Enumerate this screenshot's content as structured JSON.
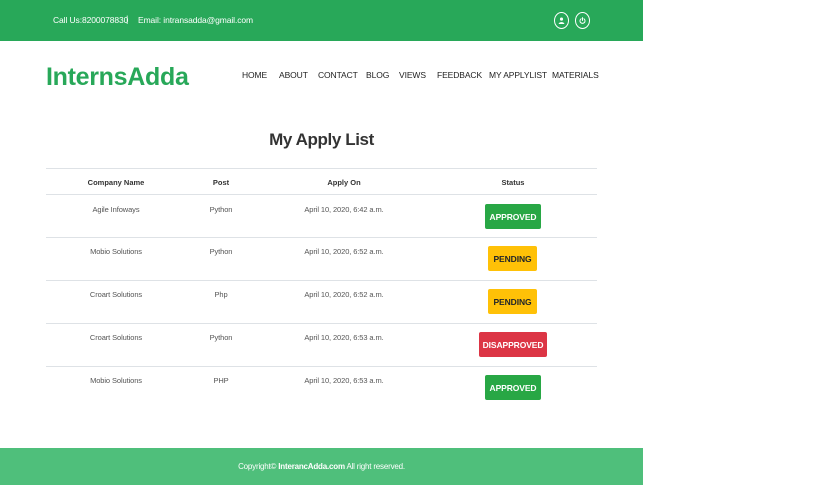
{
  "topbar": {
    "phone": "Call Us:8200078830",
    "separator": "|",
    "email": "Email: intransadda@gmail.com",
    "icons": [
      "user-icon",
      "power-icon"
    ]
  },
  "header": {
    "logo": "InternsAdda",
    "nav": [
      "HOME",
      "ABOUT",
      "CONTACT",
      "BLOG",
      "VIEWS",
      "FEEDBACK",
      "MY APPLYLIST",
      "MATERIALS"
    ]
  },
  "main": {
    "title": "My Apply List",
    "columns": [
      "Company Name",
      "Post",
      "Apply On",
      "Status"
    ],
    "rows": [
      {
        "company": "Agile Infoways",
        "post": "Python",
        "apply_on": "April 10, 2020, 6:42 a.m.",
        "status": "APPROVED"
      },
      {
        "company": "Mobio Solutions",
        "post": "Python",
        "apply_on": "April 10, 2020, 6:52 a.m.",
        "status": "PENDING"
      },
      {
        "company": "Croart Solutions",
        "post": "Php",
        "apply_on": "April 10, 2020, 6:52 a.m.",
        "status": "PENDING"
      },
      {
        "company": "Croart Solutions",
        "post": "Python",
        "apply_on": "April 10, 2020, 6:53 a.m.",
        "status": "DISAPPROVED"
      },
      {
        "company": "Mobio Solutions",
        "post": "PHP",
        "apply_on": "April 10, 2020, 6:53 a.m.",
        "status": "APPROVED"
      }
    ]
  },
  "footer": {
    "prefix": "Copyright© ",
    "brand": "InterancAdda.com",
    "suffix": " All right reserved."
  },
  "colors": {
    "brand_green": "#28a859",
    "footer_green": "#4fbf7b",
    "approved": "#28a745",
    "pending": "#ffc107",
    "disapproved": "#dc3545"
  }
}
